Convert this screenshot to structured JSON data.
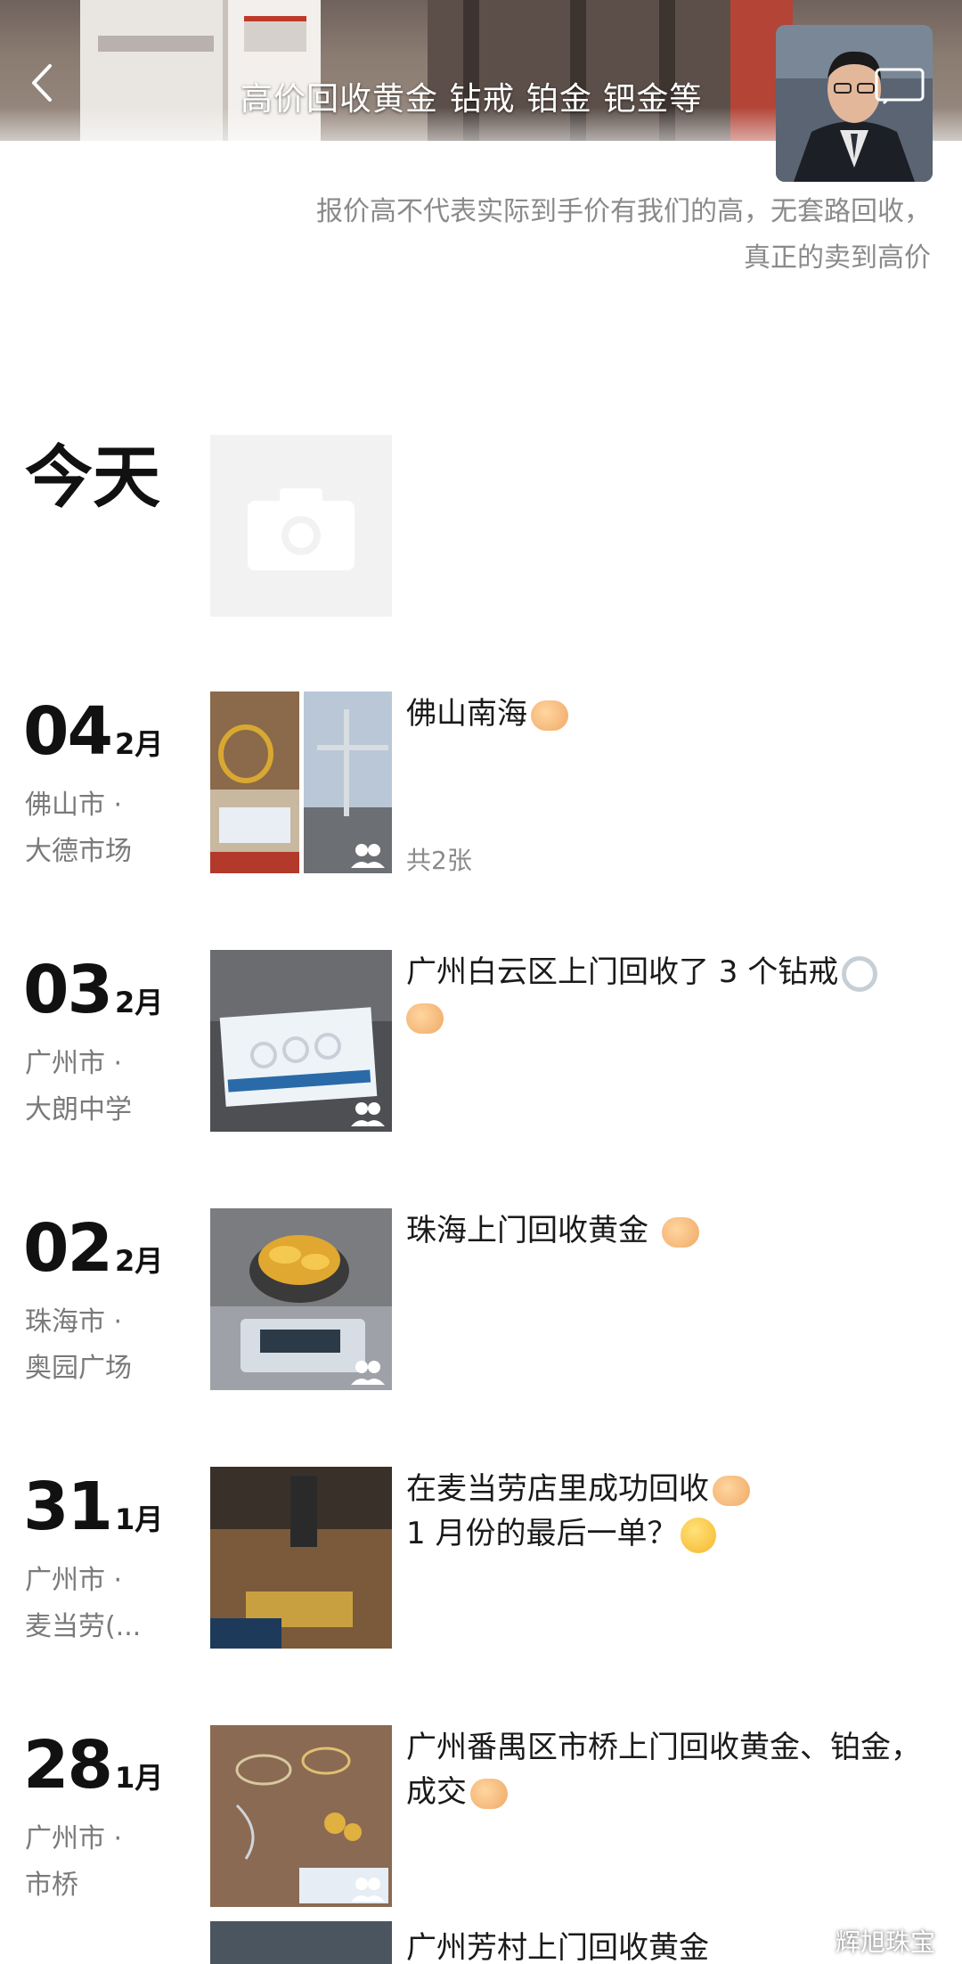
{
  "header": {
    "cover_title": "高价回收黄金 钻戒 铂金 钯金等",
    "back_icon": "back-arrow-icon",
    "camera_icon": "camera-icon"
  },
  "profile": {
    "signature_line1": "报价高不代表实际到手价有我们的高，无套路回收，",
    "signature_line2": "真正的卖到高价"
  },
  "today": {
    "label": "今天"
  },
  "feed": [
    {
      "day": "04",
      "month": "2月",
      "city": "佛山市 ·",
      "place": "大德市场",
      "text": "佛山南海",
      "count": "共2张"
    },
    {
      "day": "03",
      "month": "2月",
      "city": "广州市 ·",
      "place": "大朗中学",
      "text": "广州白云区上门回收了 3 个钻戒"
    },
    {
      "day": "02",
      "month": "2月",
      "city": "珠海市 ·",
      "place": "奥园广场",
      "text": "珠海上门回收黄金 "
    },
    {
      "day": "31",
      "month": "1月",
      "city": "广州市 ·",
      "place": "麦当劳(...",
      "text_line1": "在麦当劳店里成功回收",
      "text_line2": "1 月份的最后一单？"
    },
    {
      "day": "28",
      "month": "1月",
      "city": "广州市 ·",
      "place": "市桥",
      "text_line1": "广州番禺区市桥上门回收黄金、铂金，",
      "text_line2": "成交"
    }
  ],
  "next_entry": {
    "text": "广州芳村上门回收黄金"
  },
  "watermark": {
    "text": "辉旭珠宝"
  }
}
